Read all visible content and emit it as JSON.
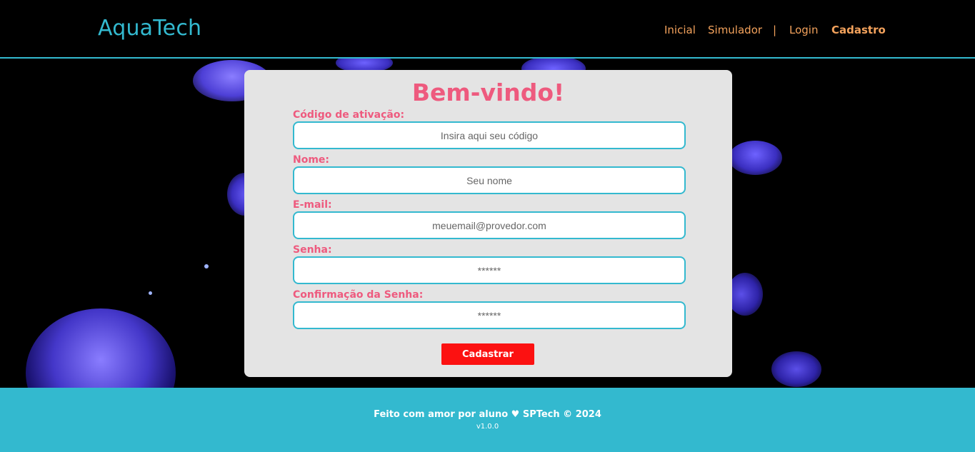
{
  "header": {
    "logo": "AquaTech",
    "nav": {
      "home": "Inicial",
      "simulator": "Simulador",
      "separator": "|",
      "login": "Login",
      "signup": "Cadastro"
    }
  },
  "form": {
    "title": "Bem-vindo!",
    "fields": [
      {
        "label": "Código de ativação:",
        "placeholder": "Insira aqui seu código",
        "value": ""
      },
      {
        "label": "Nome:",
        "placeholder": "Seu nome",
        "value": ""
      },
      {
        "label": "E-mail:",
        "placeholder": "meuemail@provedor.com",
        "value": ""
      },
      {
        "label": "Senha:",
        "placeholder": "******",
        "value": ""
      },
      {
        "label": "Confirmação da Senha:",
        "placeholder": "******",
        "value": ""
      }
    ],
    "submit_label": "Cadastrar"
  },
  "footer": {
    "text": "Feito com amor por aluno ♥ SPTech © 2024",
    "version": "v1.0.0"
  },
  "colors": {
    "accent": "#33b9cf",
    "nav_link": "#f3a25c",
    "label": "#ee5a7e",
    "button": "#fc1111",
    "card": "#e4e4e4"
  }
}
